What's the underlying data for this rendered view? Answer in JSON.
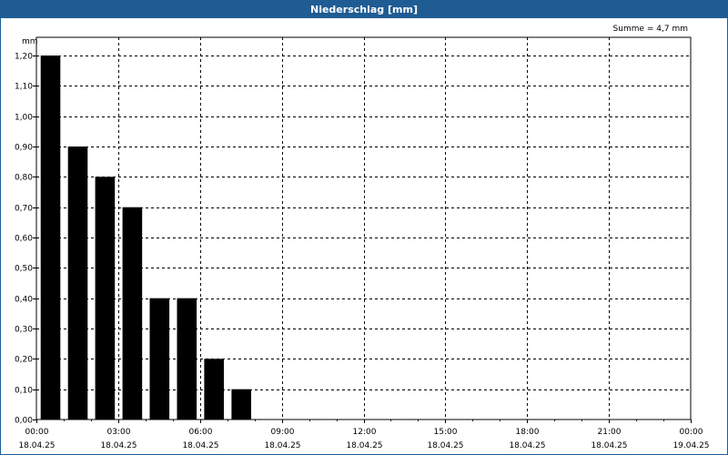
{
  "window": {
    "title": "Niederschlag [mm]"
  },
  "chart_data": {
    "type": "bar",
    "title": "Niederschlag [mm]",
    "ylabel": "mm",
    "annotation": "Summe = 4,7 mm",
    "ylim": [
      0,
      1.2
    ],
    "yticks": [
      "0,00",
      "0,10",
      "0,20",
      "0,30",
      "0,40",
      "0,50",
      "0,60",
      "0,70",
      "0,80",
      "0,90",
      "1,00",
      "1,10",
      "1,20"
    ],
    "xticks": [
      {
        "time": "00:00",
        "date": "18.04.25"
      },
      {
        "time": "03:00",
        "date": "18.04.25"
      },
      {
        "time": "06:00",
        "date": "18.04.25"
      },
      {
        "time": "09:00",
        "date": "18.04.25"
      },
      {
        "time": "12:00",
        "date": "18.04.25"
      },
      {
        "time": "15:00",
        "date": "18.04.25"
      },
      {
        "time": "18:00",
        "date": "18.04.25"
      },
      {
        "time": "21:00",
        "date": "18.04.25"
      },
      {
        "time": "00:00",
        "date": "19.04.25"
      }
    ],
    "categories": [
      "00:00",
      "01:00",
      "02:00",
      "03:00",
      "04:00",
      "05:00",
      "06:00",
      "07:00"
    ],
    "values": [
      1.2,
      0.9,
      0.8,
      0.7,
      0.4,
      0.4,
      0.2,
      0.1
    ],
    "grid": true,
    "bar_color": "#000000"
  }
}
